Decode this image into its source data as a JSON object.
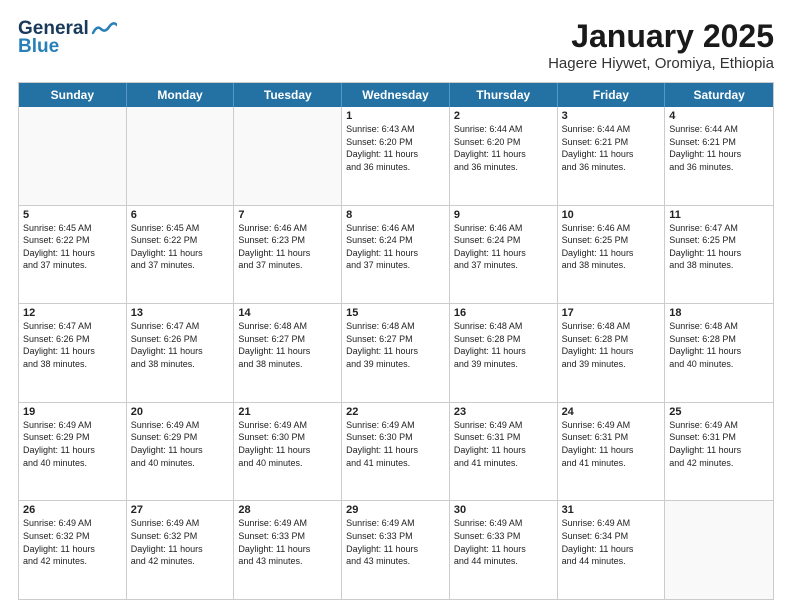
{
  "logo": {
    "general": "General",
    "blue": "Blue"
  },
  "title": "January 2025",
  "subtitle": "Hagere Hiywet, Oromiya, Ethiopia",
  "days": [
    "Sunday",
    "Monday",
    "Tuesday",
    "Wednesday",
    "Thursday",
    "Friday",
    "Saturday"
  ],
  "weeks": [
    [
      {
        "day": "",
        "info": ""
      },
      {
        "day": "",
        "info": ""
      },
      {
        "day": "",
        "info": ""
      },
      {
        "day": "1",
        "info": "Sunrise: 6:43 AM\nSunset: 6:20 PM\nDaylight: 11 hours\nand 36 minutes."
      },
      {
        "day": "2",
        "info": "Sunrise: 6:44 AM\nSunset: 6:20 PM\nDaylight: 11 hours\nand 36 minutes."
      },
      {
        "day": "3",
        "info": "Sunrise: 6:44 AM\nSunset: 6:21 PM\nDaylight: 11 hours\nand 36 minutes."
      },
      {
        "day": "4",
        "info": "Sunrise: 6:44 AM\nSunset: 6:21 PM\nDaylight: 11 hours\nand 36 minutes."
      }
    ],
    [
      {
        "day": "5",
        "info": "Sunrise: 6:45 AM\nSunset: 6:22 PM\nDaylight: 11 hours\nand 37 minutes."
      },
      {
        "day": "6",
        "info": "Sunrise: 6:45 AM\nSunset: 6:22 PM\nDaylight: 11 hours\nand 37 minutes."
      },
      {
        "day": "7",
        "info": "Sunrise: 6:46 AM\nSunset: 6:23 PM\nDaylight: 11 hours\nand 37 minutes."
      },
      {
        "day": "8",
        "info": "Sunrise: 6:46 AM\nSunset: 6:24 PM\nDaylight: 11 hours\nand 37 minutes."
      },
      {
        "day": "9",
        "info": "Sunrise: 6:46 AM\nSunset: 6:24 PM\nDaylight: 11 hours\nand 37 minutes."
      },
      {
        "day": "10",
        "info": "Sunrise: 6:46 AM\nSunset: 6:25 PM\nDaylight: 11 hours\nand 38 minutes."
      },
      {
        "day": "11",
        "info": "Sunrise: 6:47 AM\nSunset: 6:25 PM\nDaylight: 11 hours\nand 38 minutes."
      }
    ],
    [
      {
        "day": "12",
        "info": "Sunrise: 6:47 AM\nSunset: 6:26 PM\nDaylight: 11 hours\nand 38 minutes."
      },
      {
        "day": "13",
        "info": "Sunrise: 6:47 AM\nSunset: 6:26 PM\nDaylight: 11 hours\nand 38 minutes."
      },
      {
        "day": "14",
        "info": "Sunrise: 6:48 AM\nSunset: 6:27 PM\nDaylight: 11 hours\nand 38 minutes."
      },
      {
        "day": "15",
        "info": "Sunrise: 6:48 AM\nSunset: 6:27 PM\nDaylight: 11 hours\nand 39 minutes."
      },
      {
        "day": "16",
        "info": "Sunrise: 6:48 AM\nSunset: 6:28 PM\nDaylight: 11 hours\nand 39 minutes."
      },
      {
        "day": "17",
        "info": "Sunrise: 6:48 AM\nSunset: 6:28 PM\nDaylight: 11 hours\nand 39 minutes."
      },
      {
        "day": "18",
        "info": "Sunrise: 6:48 AM\nSunset: 6:28 PM\nDaylight: 11 hours\nand 40 minutes."
      }
    ],
    [
      {
        "day": "19",
        "info": "Sunrise: 6:49 AM\nSunset: 6:29 PM\nDaylight: 11 hours\nand 40 minutes."
      },
      {
        "day": "20",
        "info": "Sunrise: 6:49 AM\nSunset: 6:29 PM\nDaylight: 11 hours\nand 40 minutes."
      },
      {
        "day": "21",
        "info": "Sunrise: 6:49 AM\nSunset: 6:30 PM\nDaylight: 11 hours\nand 40 minutes."
      },
      {
        "day": "22",
        "info": "Sunrise: 6:49 AM\nSunset: 6:30 PM\nDaylight: 11 hours\nand 41 minutes."
      },
      {
        "day": "23",
        "info": "Sunrise: 6:49 AM\nSunset: 6:31 PM\nDaylight: 11 hours\nand 41 minutes."
      },
      {
        "day": "24",
        "info": "Sunrise: 6:49 AM\nSunset: 6:31 PM\nDaylight: 11 hours\nand 41 minutes."
      },
      {
        "day": "25",
        "info": "Sunrise: 6:49 AM\nSunset: 6:31 PM\nDaylight: 11 hours\nand 42 minutes."
      }
    ],
    [
      {
        "day": "26",
        "info": "Sunrise: 6:49 AM\nSunset: 6:32 PM\nDaylight: 11 hours\nand 42 minutes."
      },
      {
        "day": "27",
        "info": "Sunrise: 6:49 AM\nSunset: 6:32 PM\nDaylight: 11 hours\nand 42 minutes."
      },
      {
        "day": "28",
        "info": "Sunrise: 6:49 AM\nSunset: 6:33 PM\nDaylight: 11 hours\nand 43 minutes."
      },
      {
        "day": "29",
        "info": "Sunrise: 6:49 AM\nSunset: 6:33 PM\nDaylight: 11 hours\nand 43 minutes."
      },
      {
        "day": "30",
        "info": "Sunrise: 6:49 AM\nSunset: 6:33 PM\nDaylight: 11 hours\nand 44 minutes."
      },
      {
        "day": "31",
        "info": "Sunrise: 6:49 AM\nSunset: 6:34 PM\nDaylight: 11 hours\nand 44 minutes."
      },
      {
        "day": "",
        "info": ""
      }
    ]
  ]
}
